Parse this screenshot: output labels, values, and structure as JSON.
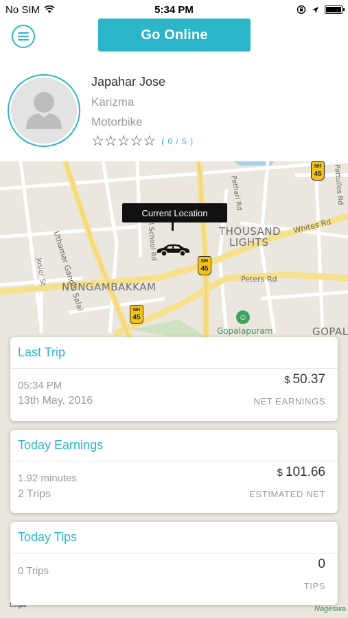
{
  "status_bar": {
    "carrier": "No SIM",
    "time": "5:34 PM"
  },
  "header": {
    "go_online_label": "Go Online"
  },
  "profile": {
    "name": "Japahar Jose",
    "vehicle_model": "Karizma",
    "vehicle_type": "Motorbike",
    "rating_value": 0,
    "rating_max": 5,
    "rating_text": "( 0 / 5 )"
  },
  "map": {
    "tooltip": "Current Location",
    "areas": {
      "thousand_lights": "THOUSAND",
      "thousand_lights_2": "LIGHTS",
      "nungambakkam": "NUNGAMBAKKAM",
      "gopal": "GOPAL"
    },
    "roads": {
      "uthamar": "Uthamar Gandhi Salai",
      "whites": "Whites Rd",
      "peters": "Peters Rd",
      "pathari": "Pathari Rd",
      "pattullos": "Pattullos Rd",
      "model_school": "Model School Rd",
      "josier": "Josier St"
    },
    "poi": "Gopalapuram",
    "highway": "NH",
    "highway_num": "45",
    "legal": "Legal",
    "street_bottom": "Nageswa"
  },
  "cards": {
    "last_trip": {
      "title": "Last Trip",
      "time": "05:34 PM",
      "date": "13th May, 2016",
      "currency": "$",
      "amount": "50.37",
      "caption": "NET EARNINGS"
    },
    "today_earnings": {
      "title": "Today Earnings",
      "duration": "1.92 minutes",
      "trips": "2 Trips",
      "currency": "$",
      "amount": "101.66",
      "caption": "ESTIMATED NET"
    },
    "today_tips": {
      "title": "Today Tips",
      "trips": "0 Trips",
      "amount": "0",
      "caption": "TIPS"
    }
  },
  "colors": {
    "accent": "#2bb5c8",
    "map_bg": "#ebe7df"
  }
}
